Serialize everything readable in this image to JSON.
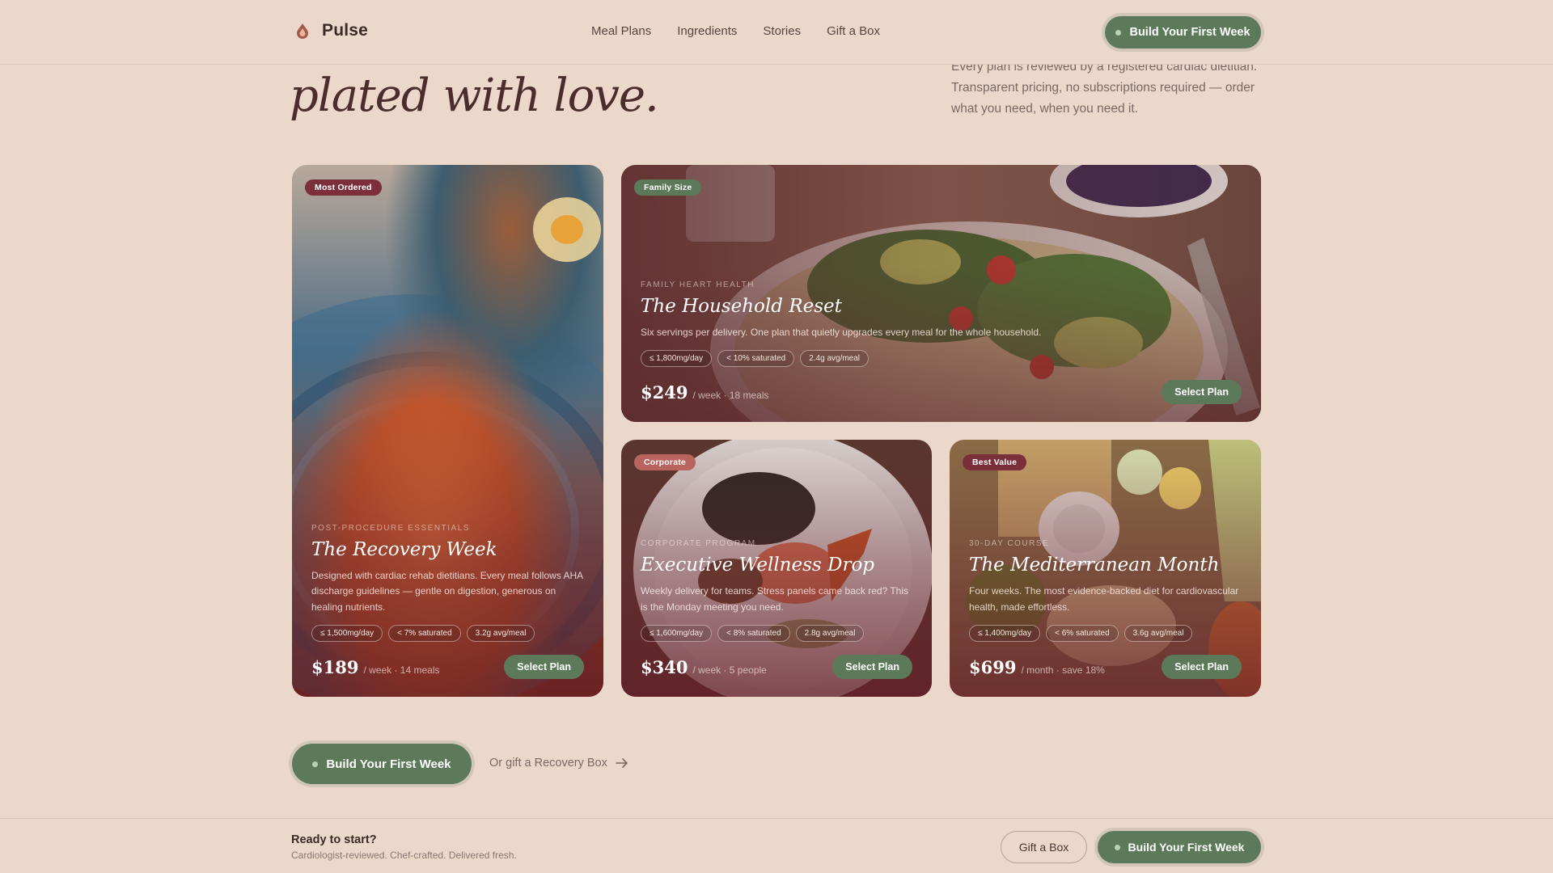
{
  "header": {
    "brand": "Pulse",
    "nav": [
      "Meal Plans",
      "Ingredients",
      "Stories",
      "Gift a Box"
    ],
    "cta_label": "Build Your First Week"
  },
  "hero": {
    "title_line": "plated with love.",
    "description": "Every plan is reviewed by a registered cardiac dietitian. Transparent pricing, no subscriptions required — order what you need, when you need it."
  },
  "cards": [
    {
      "badge": "Most Ordered",
      "eyebrow": "Post-Procedure Essentials",
      "title": "The Recovery Week",
      "description": "Designed with cardiac rehab dietitians. Every meal follows AHA discharge guidelines — gentle on digestion, generous on healing nutrients.",
      "chips": [
        "≤ 1,500mg/day",
        "< 7% saturated",
        "3.2g avg/meal"
      ],
      "price": "$189",
      "price_unit": "/ week · 14 meals",
      "select_label": "Select Plan"
    },
    {
      "badge": "Family Size",
      "eyebrow": "Family Heart Health",
      "title": "The Household Reset",
      "description": "Six servings per delivery. One plan that quietly upgrades every meal for the whole household.",
      "chips": [
        "≤ 1,800mg/day",
        "< 10% saturated",
        "2.4g avg/meal"
      ],
      "price": "$249",
      "price_unit": "/ week · 18 meals",
      "select_label": "Select Plan"
    },
    {
      "badge": "Corporate",
      "eyebrow": "Corporate Program",
      "title": "Executive Wellness Drop",
      "description": "Weekly delivery for teams. Stress panels came back red? This is the Monday meeting you need.",
      "chips": [
        "≤ 1,600mg/day",
        "< 8% saturated",
        "2.8g avg/meal"
      ],
      "price": "$340",
      "price_unit": "/ week · 5 people",
      "select_label": "Select Plan"
    },
    {
      "badge": "Best Value",
      "eyebrow": "30-Day Course",
      "title": "The Mediterranean Month",
      "description": "Four weeks. The most evidence-backed diet for cardiovascular health, made effortless.",
      "chips": [
        "≤ 1,400mg/day",
        "< 6% saturated",
        "3.6g avg/meal"
      ],
      "price": "$699",
      "price_unit": "/ month · save 18%",
      "select_label": "Select Plan"
    }
  ],
  "cta_row": {
    "primary_label": "Build Your First Week",
    "secondary_label": "Or gift a Recovery Box"
  },
  "sticky": {
    "title": "Ready to start?",
    "subtitle": "Cardiologist-reviewed. Chef-crafted. Delivered fresh.",
    "gift_label": "Gift a Box",
    "cta_label": "Build Your First Week"
  },
  "colors": {
    "background": "#ecd8cb",
    "accent_green": "#5c7a59",
    "badge_dark": "#7a2f3a",
    "badge_green": "#5c7a59",
    "badge_rose": "#b9645f"
  }
}
